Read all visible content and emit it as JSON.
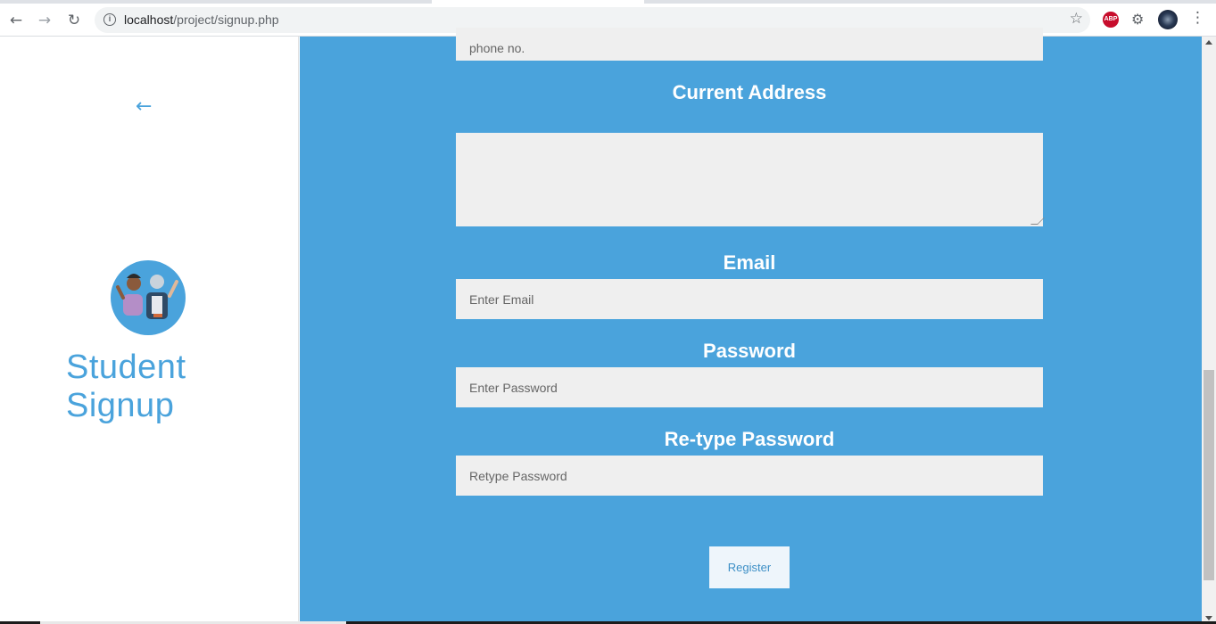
{
  "browser": {
    "url_host": "localhost",
    "url_path": "/project/signup.php",
    "icons": [
      "back-icon",
      "forward-icon",
      "reload-icon",
      "info-icon",
      "star-icon",
      "adblock-icon",
      "extensions-icon",
      "profile-avatar",
      "menu-icon"
    ],
    "adblock_label": "ABP"
  },
  "left": {
    "back_icon": "arrow-left-icon",
    "title": "Student Signup"
  },
  "form": {
    "phone_placeholder": "phone no.",
    "address_label": "Current Address",
    "address_value": "",
    "email_label": "Email",
    "email_placeholder": "Enter Email",
    "password_label": "Password",
    "password_placeholder": "Enter Password",
    "retype_label": "Re-type Password",
    "retype_placeholder": "Retype Password",
    "register_label": "Register"
  },
  "colors": {
    "accent": "#4aa3dc",
    "field_bg": "#efefef",
    "button_bg": "#eef5fb"
  }
}
